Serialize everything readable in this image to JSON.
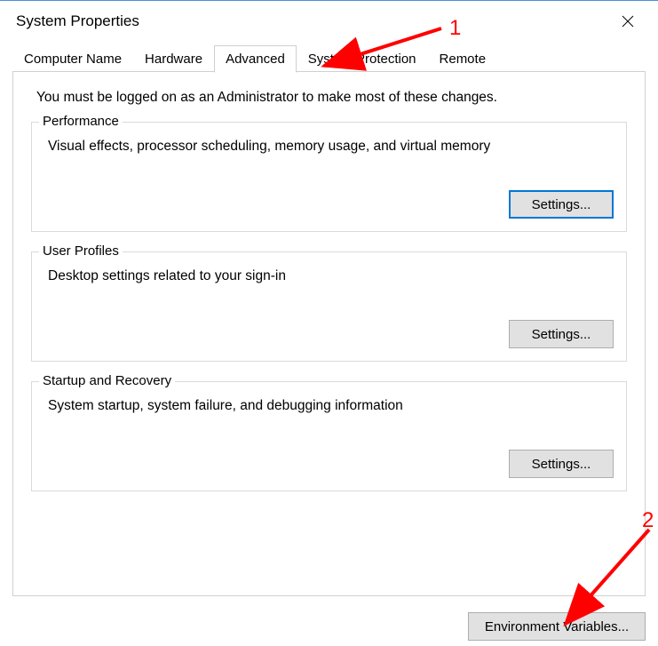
{
  "window": {
    "title": "System Properties"
  },
  "tabs": [
    {
      "label": "Computer Name"
    },
    {
      "label": "Hardware"
    },
    {
      "label": "Advanced"
    },
    {
      "label": "System Protection"
    },
    {
      "label": "Remote"
    }
  ],
  "active_tab_index": 2,
  "advanced": {
    "intro": "You must be logged on as an Administrator to make most of these changes.",
    "groups": [
      {
        "title": "Performance",
        "desc": "Visual effects, processor scheduling, memory usage, and virtual memory",
        "button": "Settings..."
      },
      {
        "title": "User Profiles",
        "desc": "Desktop settings related to your sign-in",
        "button": "Settings..."
      },
      {
        "title": "Startup and Recovery",
        "desc": "System startup, system failure, and debugging information",
        "button": "Settings..."
      }
    ],
    "env_button": "Environment Variables..."
  },
  "annotations": {
    "label1": "1",
    "label2": "2"
  }
}
